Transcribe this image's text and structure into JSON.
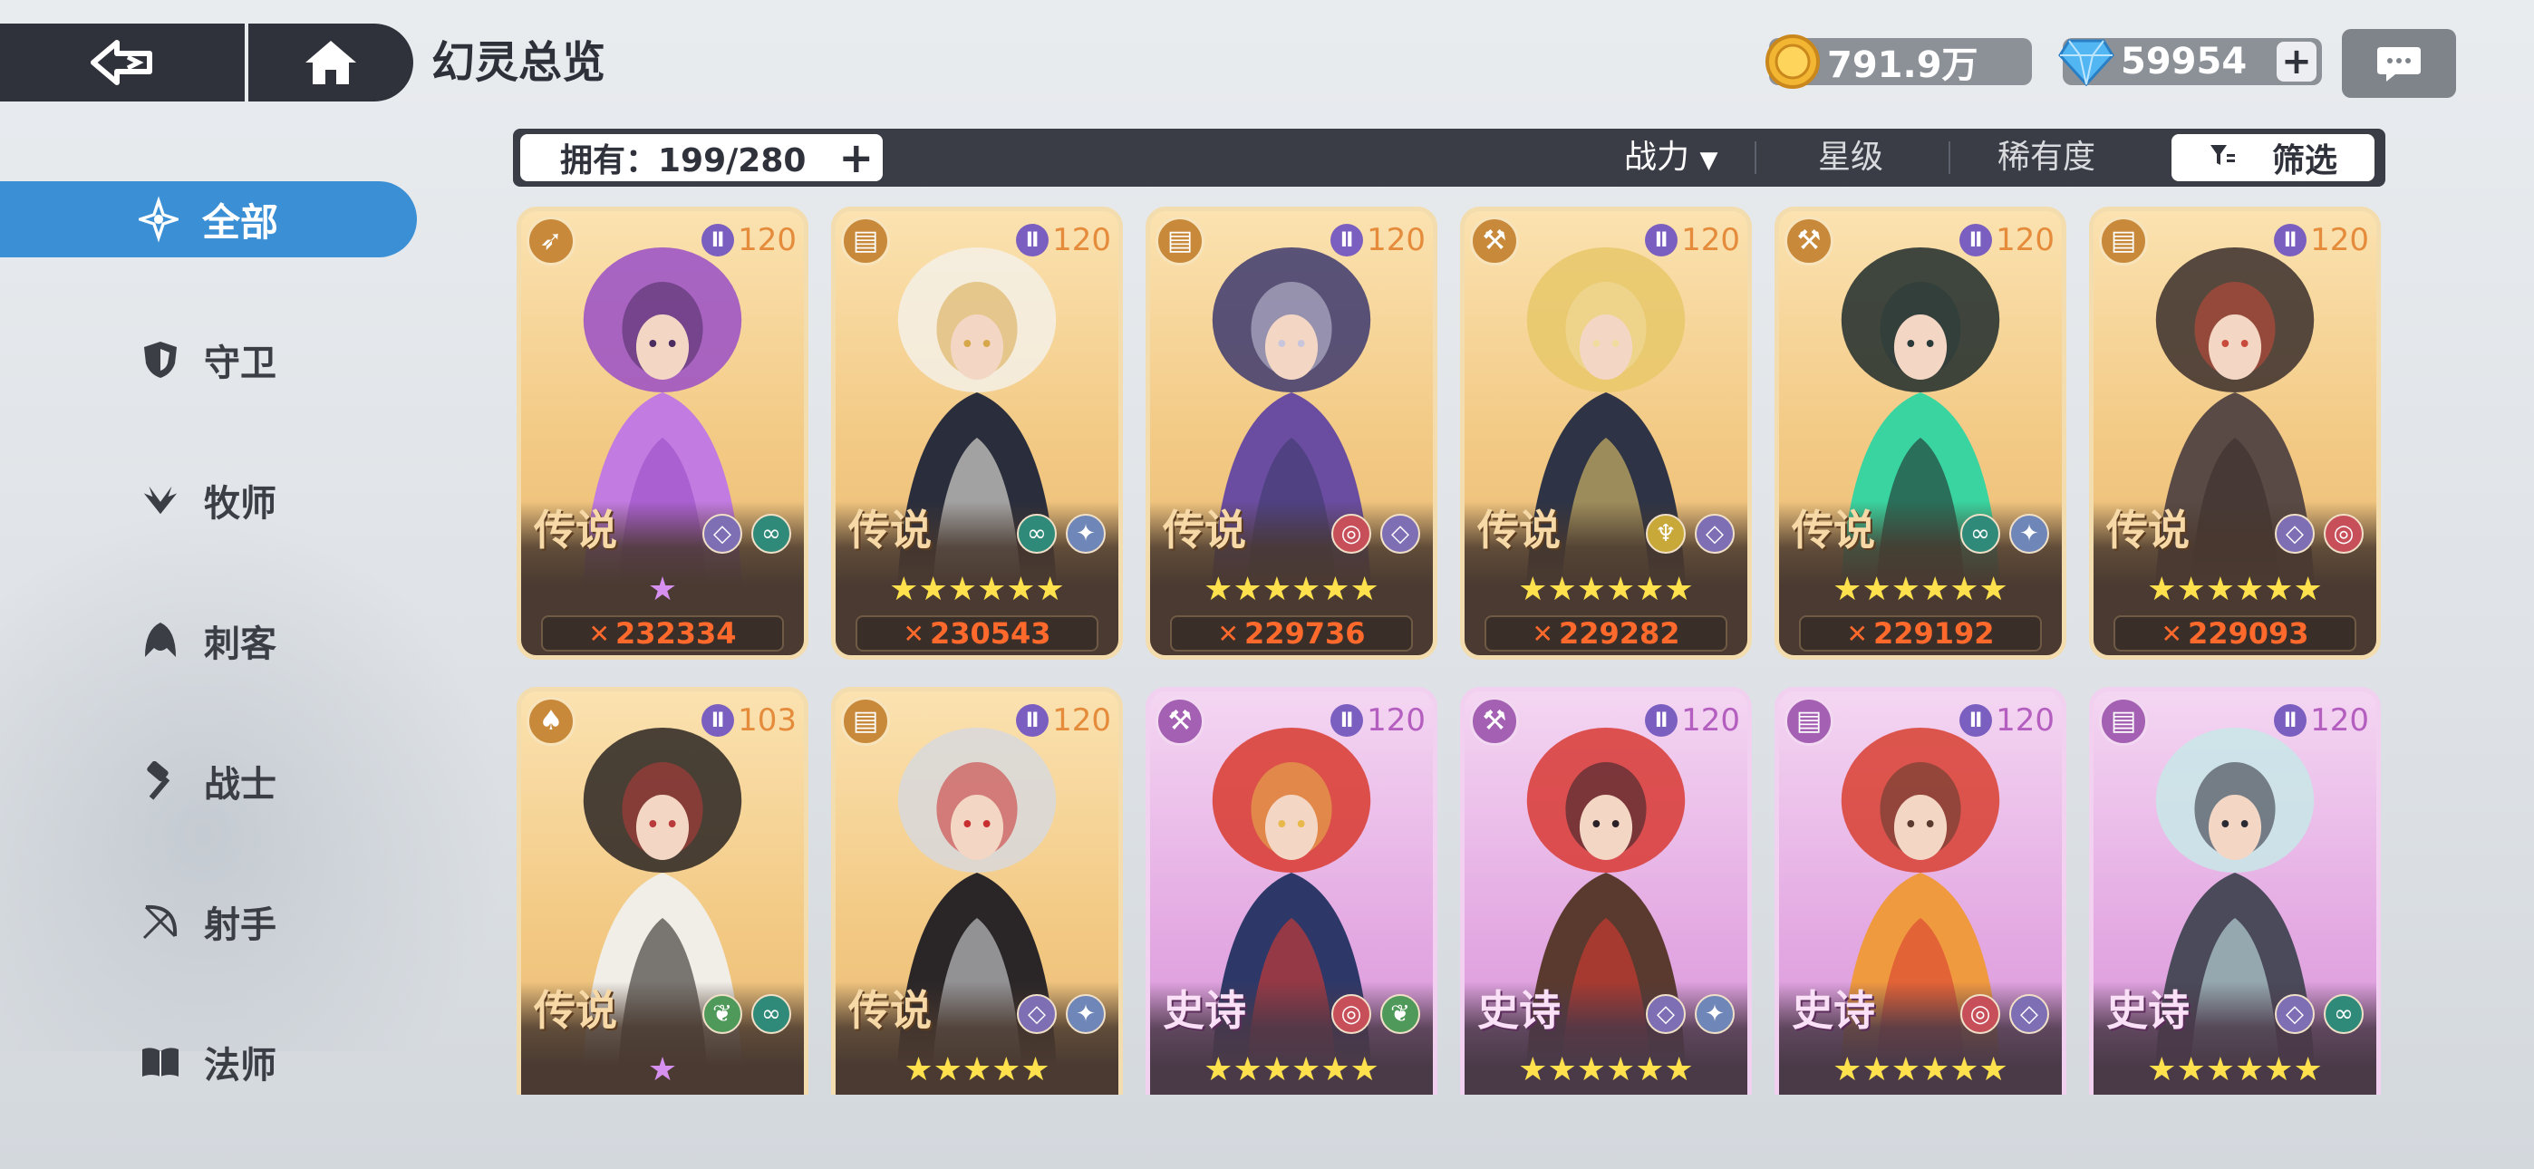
{
  "header": {
    "title": "幻灵总览",
    "gold": "791.9万",
    "gems": "59954"
  },
  "sidebar": {
    "items": [
      {
        "label": "全部",
        "icon": "star-compass-icon",
        "active": true
      },
      {
        "label": "守卫",
        "icon": "shield-icon"
      },
      {
        "label": "牧师",
        "icon": "wings-icon"
      },
      {
        "label": "刺客",
        "icon": "hood-icon"
      },
      {
        "label": "战士",
        "icon": "hammer-icon"
      },
      {
        "label": "射手",
        "icon": "bow-icon"
      },
      {
        "label": "法师",
        "icon": "book-icon"
      }
    ]
  },
  "filter_bar": {
    "owned": "拥有：199/280",
    "sort_power": "战力",
    "sort_star": "星级",
    "sort_rarity": "稀有度",
    "filter": "筛选"
  },
  "cards": [
    {
      "rarity": "传说",
      "tier": "Ⅱ",
      "level": "120",
      "class": "bow-icon",
      "stars": "★",
      "star_type": "purple",
      "power": "232334",
      "palette": [
        "#9a4fc7",
        "#c27be0",
        "#4a2c60"
      ]
    },
    {
      "rarity": "传说",
      "tier": "Ⅱ",
      "level": "120",
      "class": "book-icon",
      "stars": "★★★★★★",
      "star_type": "gold",
      "power": "230543",
      "palette": [
        "#f5f0e6",
        "#2a2e3c",
        "#d7a84a"
      ]
    },
    {
      "rarity": "传说",
      "tier": "Ⅱ",
      "level": "120",
      "class": "book-icon",
      "stars": "★★★★★★",
      "star_type": "gold",
      "power": "229736",
      "palette": [
        "#3d3a6e",
        "#6a4da0",
        "#c8c6dc"
      ]
    },
    {
      "rarity": "传说",
      "tier": "Ⅱ",
      "level": "120",
      "class": "hammer-icon",
      "stars": "★★★★★★",
      "star_type": "gold",
      "power": "229282",
      "palette": [
        "#e8c86a",
        "#2e3445",
        "#f1dca0"
      ]
    },
    {
      "rarity": "传说",
      "tier": "Ⅱ",
      "level": "120",
      "class": "hammer-icon",
      "stars": "★★★★★★",
      "star_type": "gold",
      "power": "229192",
      "palette": [
        "#1f2b2c",
        "#3ad4a0",
        "#2a3a3a"
      ]
    },
    {
      "rarity": "传说",
      "tier": "Ⅱ",
      "level": "120",
      "class": "book-icon",
      "stars": "★★★★★★",
      "star_type": "gold",
      "power": "229093",
      "palette": [
        "#3a2e2c",
        "#5a4a46",
        "#c84a3a"
      ]
    },
    {
      "rarity": "传说",
      "tier": "Ⅱ",
      "level": "103",
      "class": "hood-icon",
      "stars": "★",
      "star_type": "purple",
      "power": "",
      "palette": [
        "#2a2422",
        "#f1eee8",
        "#b83a3a"
      ]
    },
    {
      "rarity": "传说",
      "tier": "Ⅱ",
      "level": "120",
      "class": "book-icon",
      "stars": "★★★★★",
      "star_type": "gold",
      "power": "",
      "palette": [
        "#d8d8dc",
        "#2a2628",
        "#c83030"
      ]
    },
    {
      "rarity": "史诗",
      "tier": "Ⅱ",
      "level": "120",
      "class": "hammer-icon",
      "stars": "★★★★★★",
      "star_type": "gold",
      "power": "",
      "palette": [
        "#d83a2e",
        "#2e3868",
        "#e8b84a"
      ]
    },
    {
      "rarity": "史诗",
      "tier": "Ⅱ",
      "level": "120",
      "class": "hammer-icon",
      "stars": "★★★★★★",
      "star_type": "gold",
      "power": "",
      "palette": [
        "#d83a34",
        "#5a3a2e",
        "#2a2228"
      ]
    },
    {
      "rarity": "史诗",
      "tier": "Ⅱ",
      "level": "120",
      "class": "book-icon",
      "stars": "★★★★★★",
      "star_type": "gold",
      "power": "",
      "palette": [
        "#d84030",
        "#f09a40",
        "#5a3a2e"
      ]
    },
    {
      "rarity": "史诗",
      "tier": "Ⅱ",
      "level": "120",
      "class": "book-icon",
      "stars": "★★★★★★",
      "star_type": "gold",
      "power": "",
      "palette": [
        "#c8e8e8",
        "#4a4a5a",
        "#2a2a34"
      ]
    }
  ],
  "colors": {
    "accent": "#3b8fd4",
    "legend_bg": "#f2c882",
    "epic_bg": "#e3a9e2",
    "power_text": "#ff6a2c"
  }
}
